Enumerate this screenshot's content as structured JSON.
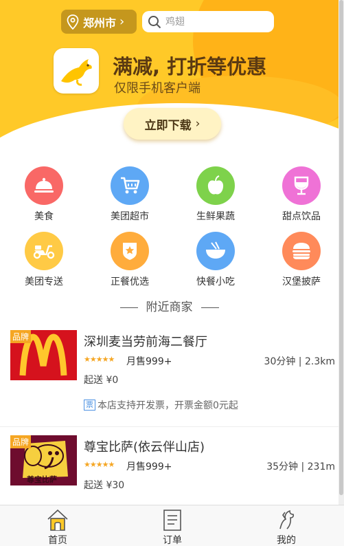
{
  "header": {
    "city": "郑州市",
    "search_placeholder": "鸡翅",
    "promo_title": "满减, 打折等优惠",
    "promo_subtitle": "仅限手机客户端",
    "download_label": "立即下载",
    "colors": {
      "banner": "#ffc928",
      "banner_dark": "#ffb318"
    }
  },
  "categories": [
    {
      "label": "美食",
      "icon": "dish-cover-icon",
      "color": "#f96866"
    },
    {
      "label": "美团超市",
      "icon": "shopping-cart-icon",
      "color": "#5ea8f5"
    },
    {
      "label": "生鲜果蔬",
      "icon": "apple-icon",
      "color": "#7ed24b"
    },
    {
      "label": "甜点饮品",
      "icon": "drink-glass-icon",
      "color": "#ef72d6"
    },
    {
      "label": "美团专送",
      "icon": "scooter-icon",
      "color": "#ffca45"
    },
    {
      "label": "正餐优选",
      "icon": "star-badge-icon",
      "color": "#ffac3c"
    },
    {
      "label": "快餐小吃",
      "icon": "noodle-bowl-icon",
      "color": "#5ea8f5"
    },
    {
      "label": "汉堡披萨",
      "icon": "burger-icon",
      "color": "#ff8a5a"
    }
  ],
  "section_title": "附近商家",
  "shops": [
    {
      "badge": "品牌",
      "name": "深圳麦当劳前海二餐厅",
      "stars": "★★★★★",
      "monthly_sales": "月售999+",
      "eta_distance": "30分钟 | 2.3km",
      "min_order": "起送 ¥0",
      "invoice_tag": "票",
      "invoice_text": "本店支持开发票，开票金额0元起",
      "logo": "mcdonalds-logo"
    },
    {
      "badge": "品牌",
      "name": "尊宝比萨(依云伴山店)",
      "stars": "★★★★★",
      "monthly_sales": "月售999+",
      "eta_distance": "35分钟 | 231m",
      "min_order": "起送 ¥30",
      "logo_text": "尊宝比萨",
      "logo": "zunbao-pizza-logo"
    }
  ],
  "tabbar": {
    "items": [
      {
        "label": "首页",
        "icon": "home-icon",
        "active": true
      },
      {
        "label": "订单",
        "icon": "order-list-icon",
        "active": false
      },
      {
        "label": "我的",
        "icon": "profile-kangaroo-icon",
        "active": false
      }
    ]
  }
}
